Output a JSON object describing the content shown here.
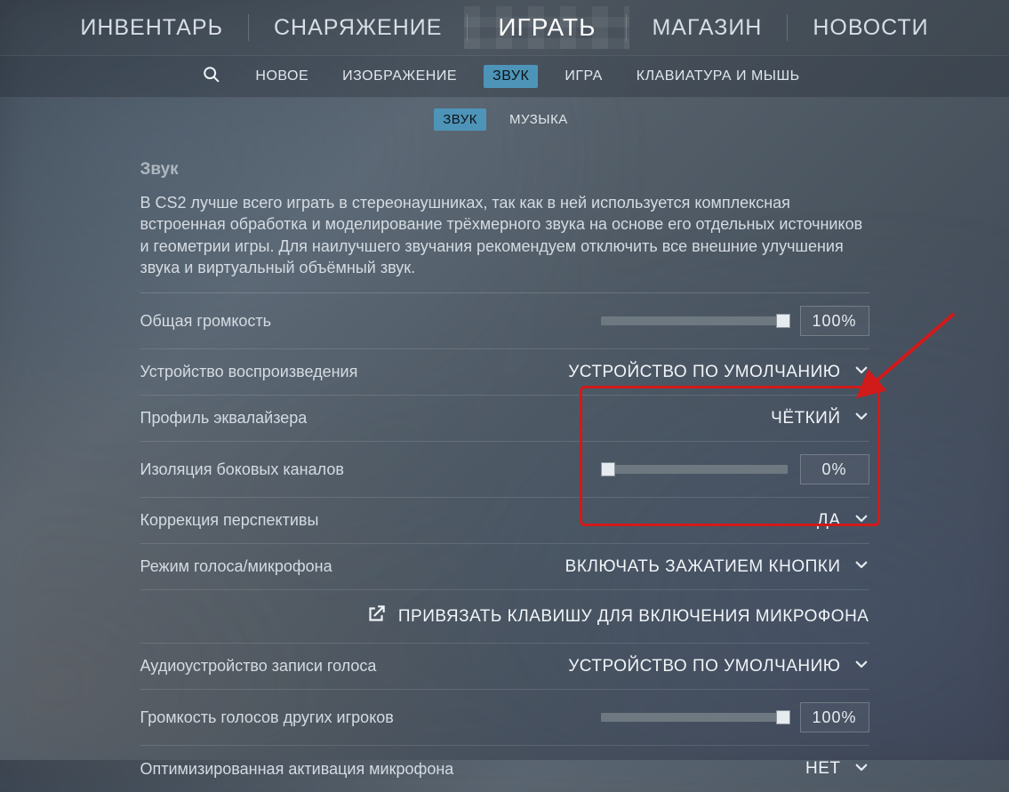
{
  "main_nav": {
    "inventory": "ИНВЕНТАРЬ",
    "loadout": "СНАРЯЖЕНИЕ",
    "play": "ИГРАТЬ",
    "store": "МАГАЗИН",
    "news": "НОВОСТИ"
  },
  "settings_tabs": {
    "new": "НОВОЕ",
    "video": "ИЗОБРАЖЕНИЕ",
    "audio": "ЗВУК",
    "game": "ИГРА",
    "keyboard": "КЛАВИАТУРА И МЫШЬ"
  },
  "sub_tabs": {
    "audio": "ЗВУК",
    "music": "МУЗЫКА"
  },
  "section": {
    "title": "Звук",
    "desc": "В CS2 лучше всего играть в стереонаушниках, так как в ней используется комплексная встроенная обработка и моделирование трёхмерного звука на основе его отдельных источников и геометрии игры. Для наилучшего звучания рекомендуем отключить все внешние улучшения звука и виртуальный объёмный звук."
  },
  "rows": {
    "master_volume": {
      "label": "Общая громкость",
      "value": "100%",
      "pct": 100
    },
    "output_device": {
      "label": "Устройство воспроизведения",
      "value": "УСТРОЙСТВО ПО УМОЛЧАНИЮ"
    },
    "eq_profile": {
      "label": "Профиль эквалайзера",
      "value": "ЧЁТКИЙ"
    },
    "lr_isolation": {
      "label": "Изоляция боковых каналов",
      "value": "0%",
      "pct": 0
    },
    "perspective": {
      "label": "Коррекция перспективы",
      "value": "ДА"
    },
    "voice_mode": {
      "label": "Режим голоса/микрофона",
      "value": "ВКЛЮЧАТЬ ЗАЖАТИЕМ КНОПКИ"
    },
    "bind_link": "ПРИВЯЗАТЬ КЛАВИШУ ДЛЯ ВКЛЮЧЕНИЯ МИКРОФОНА",
    "input_device": {
      "label": "Аудиоустройство записи голоса",
      "value": "УСТРОЙСТВО ПО УМОЛЧАНИЮ"
    },
    "voip_volume": {
      "label": "Громкость голосов других игроков",
      "value": "100%",
      "pct": 100
    },
    "streamlined": {
      "label": "Оптимизированная активация микрофона",
      "value": "НЕТ"
    }
  }
}
